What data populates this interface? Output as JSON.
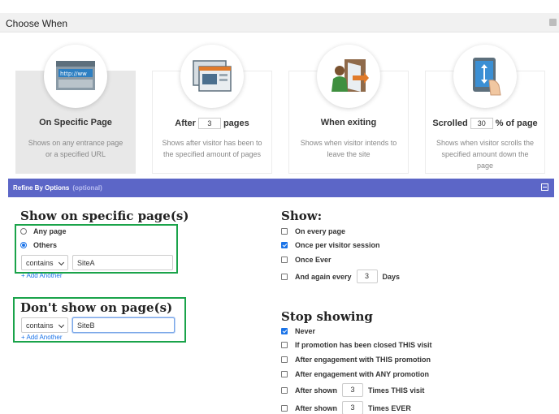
{
  "header": {
    "title": "Choose When"
  },
  "cards": [
    {
      "title": "On Specific Page",
      "desc": "Shows on any entrance page or a specified URL",
      "icon": "browser-url-icon",
      "icon_text": "http://ww"
    },
    {
      "title_pre": "After",
      "value": "3",
      "title_post": "pages",
      "desc": "Shows after visitor has been to the specified amount of pages",
      "icon": "browser-windows-icon"
    },
    {
      "title": "When exiting",
      "desc": "Shows when visitor intends to leave the site",
      "icon": "exit-door-icon"
    },
    {
      "title_pre": "Scrolled",
      "value": "30",
      "title_post": "% of page",
      "desc": "Shows when visitor scrolls the specified amount down the page",
      "icon": "tablet-scroll-icon"
    }
  ],
  "refine": {
    "title": "Refine By Options",
    "optional": "(optional)"
  },
  "show_on": {
    "heading": "Show on specific page(s)",
    "options": [
      {
        "label": "Any page",
        "selected": false
      },
      {
        "label": "Others",
        "selected": true
      }
    ],
    "match_select": "contains",
    "match_value": "SiteA",
    "add_another": "+ Add Another"
  },
  "dont_show": {
    "heading": "Don't show on page(s)",
    "match_select": "contains",
    "match_value": "SiteB",
    "add_another": "+ Add Another"
  },
  "show": {
    "heading": "Show:",
    "options": [
      {
        "label": "On every page",
        "checked": false
      },
      {
        "label": "Once per visitor session",
        "checked": true
      },
      {
        "label": "Once Ever",
        "checked": false
      }
    ],
    "again_pre": "And again every",
    "again_value": "3",
    "again_post": "Days",
    "again_checked": false
  },
  "stop": {
    "heading": "Stop showing",
    "options": [
      {
        "label": "Never",
        "checked": true
      },
      {
        "label": "If promotion has been closed THIS visit",
        "checked": false
      },
      {
        "label": "After engagement with THIS promotion",
        "checked": false
      },
      {
        "label": "After engagement with ANY promotion",
        "checked": false
      }
    ],
    "shown_visit": {
      "pre": "After shown",
      "value": "3",
      "post": "Times THIS visit",
      "checked": false
    },
    "shown_ever": {
      "pre": "After shown",
      "value": "3",
      "post": "Times EVER",
      "checked": false
    }
  },
  "colors": {
    "accent": "#5c66c7",
    "highlight": "#1aa34a",
    "link": "#1a73e8"
  }
}
